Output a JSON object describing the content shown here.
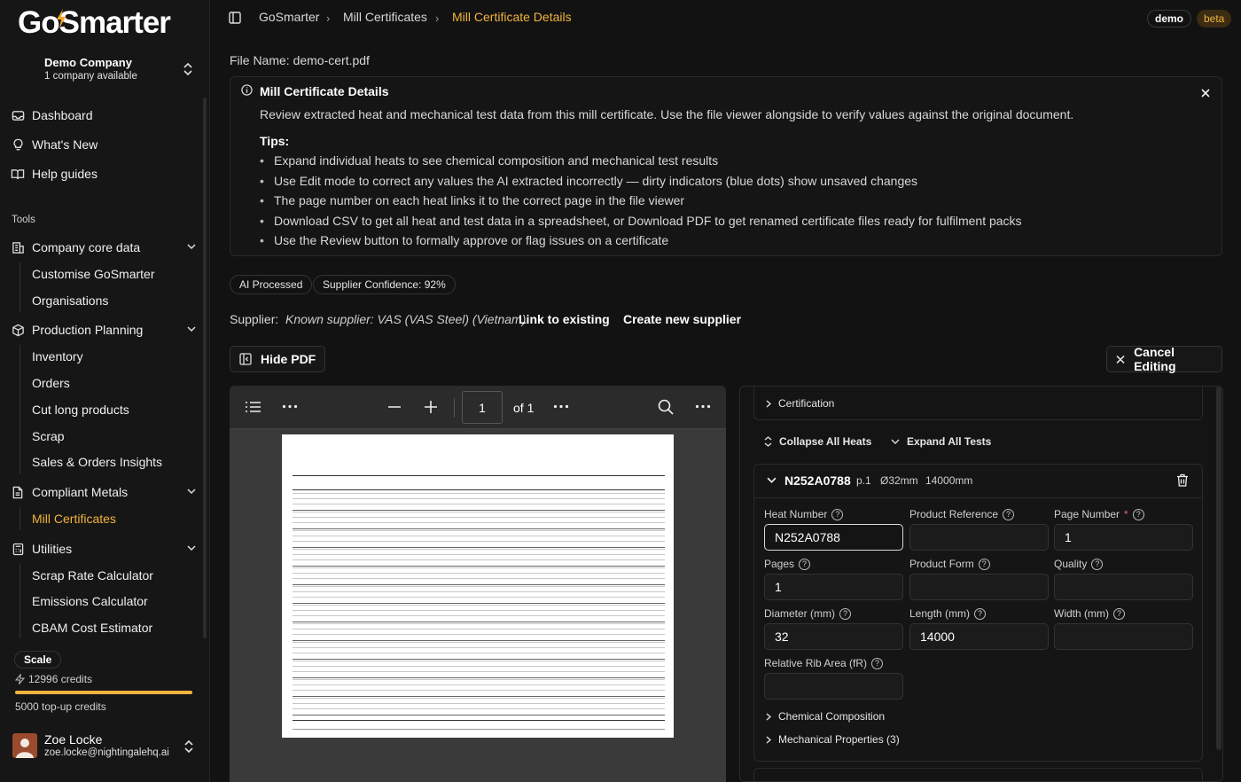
{
  "sidebar": {
    "logo": {
      "part1": "Go",
      "part2": "Smarter"
    },
    "company": {
      "name": "Demo Company",
      "sub": "1 company available"
    },
    "top_items": [
      {
        "label": "Dashboard",
        "icon": "inbox-icon"
      },
      {
        "label": "What's New",
        "icon": "lightbulb-icon"
      },
      {
        "label": "Help guides",
        "icon": "book-icon"
      }
    ],
    "tools_label": "Tools",
    "groups": [
      {
        "label": "Company core data",
        "icon": "building-icon",
        "items": [
          "Customise GoSmarter",
          "Organisations"
        ]
      },
      {
        "label": "Production Planning",
        "icon": "package-icon",
        "items": [
          "Inventory",
          "Orders",
          "Cut long products",
          "Scrap",
          "Sales & Orders Insights"
        ]
      },
      {
        "label": "Compliant Metals",
        "icon": "file-icon",
        "items": [
          "Mill Certificates"
        ]
      },
      {
        "label": "Utilities",
        "icon": "calculator-icon",
        "items": [
          "Scrap Rate Calculator",
          "Emissions Calculator",
          "CBAM Cost Estimator"
        ]
      }
    ],
    "active_item": "Mill Certificates",
    "plan": "Scale",
    "credits": "12996 credits",
    "credit_fraction": 1.0,
    "topup": "5000 top-up credits",
    "user": {
      "name": "Zoe Locke",
      "email": "zoe.locke@nightingalehq.ai"
    }
  },
  "breadcrumb": [
    "GoSmarter",
    "Mill Certificates",
    "Mill Certificate Details"
  ],
  "env_badges": {
    "demo": "demo",
    "beta": "beta"
  },
  "file_name": "File Name: demo-cert.pdf",
  "info": {
    "title": "Mill Certificate Details",
    "description": "Review extracted heat and mechanical test data from this mill certificate. Use the file viewer alongside to verify values against the original document.",
    "tips_label": "Tips:",
    "tips": [
      "Expand individual heats to see chemical composition and mechanical test results",
      "Use Edit mode to correct any values the AI extracted incorrectly — dirty indicators (blue dots) show unsaved changes",
      "The page number on each heat links it to the correct page in the file viewer",
      "Download CSV to get all heat and test data in a spreadsheet, or Download PDF to get renamed certificate files ready for fulfilment packs",
      "Use the Review button to formally approve or flag issues on a certificate"
    ]
  },
  "badges": [
    "AI Processed",
    "Supplier Confidence: 92%"
  ],
  "supplier": {
    "label": "Supplier:",
    "value": "Known supplier: VAS (VAS Steel) (Vietnam)",
    "link_existing": "Link to existing",
    "create_new": "Create new supplier"
  },
  "actions": {
    "hide_pdf": "Hide PDF",
    "cancel_editing": "Cancel Editing"
  },
  "pdf_viewer": {
    "page": "1",
    "of": "of 1"
  },
  "panel": {
    "certification": "Certification",
    "collapse_all": "Collapse All Heats",
    "expand_all": "Expand All Tests",
    "heat": {
      "number": "N252A0788",
      "page": "p.1",
      "diameter": "Ø32mm",
      "length": "14000mm",
      "fields": {
        "heat_number": {
          "label": "Heat Number",
          "value": "N252A0788"
        },
        "product_reference": {
          "label": "Product Reference",
          "value": ""
        },
        "page_number": {
          "label": "Page Number",
          "value": "1"
        },
        "pages": {
          "label": "Pages",
          "value": "1"
        },
        "product_form": {
          "label": "Product Form",
          "value": ""
        },
        "quality": {
          "label": "Quality",
          "value": ""
        },
        "diameter": {
          "label": "Diameter (mm)",
          "value": "32"
        },
        "length": {
          "label": "Length (mm)",
          "value": "14000"
        },
        "width": {
          "label": "Width (mm)",
          "value": ""
        },
        "rib_area": {
          "label": "Relative Rib Area (fR)",
          "value": ""
        }
      },
      "chemical": "Chemical Composition",
      "mechanical": "Mechanical Properties (3)"
    }
  }
}
